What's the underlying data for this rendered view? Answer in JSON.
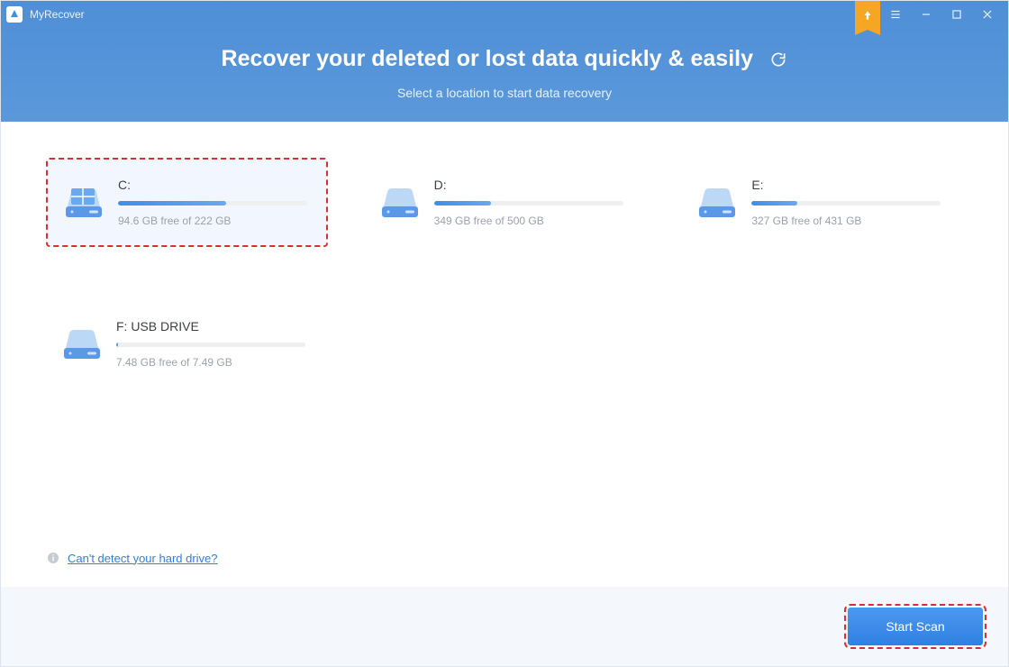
{
  "app": {
    "title": "MyRecover"
  },
  "header": {
    "headline": "Recover your deleted or lost data quickly & easily",
    "subtitle": "Select a location to start data recovery"
  },
  "drives": [
    {
      "label": "C:",
      "free_text": "94.6 GB free of 222 GB",
      "fill_pct": 57,
      "is_system": true,
      "selected": true
    },
    {
      "label": "D:",
      "free_text": "349 GB free of 500 GB",
      "fill_pct": 30,
      "is_system": false,
      "selected": false
    },
    {
      "label": "E:",
      "free_text": "327 GB free of 431 GB",
      "fill_pct": 24,
      "is_system": false,
      "selected": false
    },
    {
      "label": "F: USB DRIVE",
      "free_text": "7.48 GB free of 7.49 GB",
      "fill_pct": 1,
      "is_system": false,
      "selected": false
    }
  ],
  "help": {
    "link_text": "Can't detect your hard drive? "
  },
  "footer": {
    "scan_label": "Start Scan"
  },
  "colors": {
    "accent": "#4c8fd6",
    "danger_dash": "#d9302e"
  }
}
